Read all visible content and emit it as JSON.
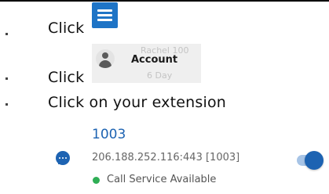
{
  "steps": [
    {
      "text": "Click"
    },
    {
      "text": "Click"
    },
    {
      "text": "Click on your extension"
    }
  ],
  "menu_button": {
    "icon": "hamburger-menu-icon",
    "color": "#1e74c6"
  },
  "account_chip": {
    "label": "Account",
    "icon": "person-icon",
    "ghost_text_1": "Rachel 100",
    "ghost_text_2": "6 Day"
  },
  "extension": {
    "number": "1003",
    "address": "206.188.252.116:443 [1003]",
    "status": "Call Service Available",
    "status_color": "#2fae55",
    "accent_color": "#1d63b2",
    "icon": "chat-bubble-icon",
    "toggle_on": true
  }
}
